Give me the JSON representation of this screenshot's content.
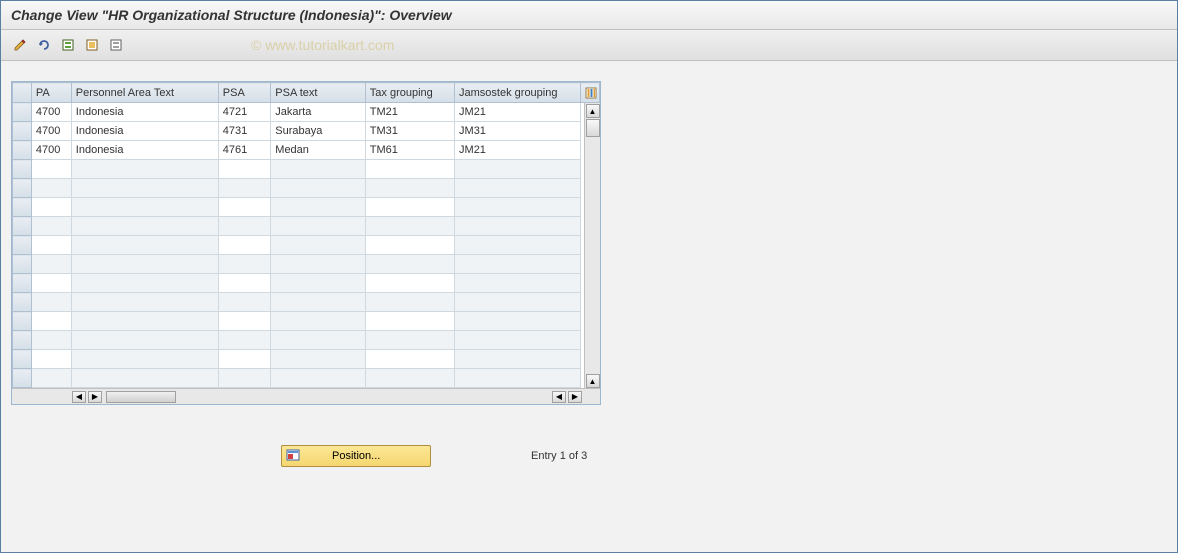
{
  "title": "Change View \"HR Organizational Structure (Indonesia)\": Overview",
  "watermark": "© www.tutorialkart.com",
  "toolbar": {
    "edit": "pencil-icon",
    "undo": "undo-icon",
    "select_all": "select-all-icon",
    "select_block": "select-block-icon",
    "deselect": "deselect-icon"
  },
  "table": {
    "columns": {
      "pa": "PA",
      "pat": "Personnel Area Text",
      "psa": "PSA",
      "psat": "PSA text",
      "tax": "Tax grouping",
      "jam": "Jamsostek grouping"
    },
    "rows": [
      {
        "pa": "4700",
        "pat": "Indonesia",
        "psa": "4721",
        "psat": "Jakarta",
        "tax": "TM21",
        "jam": "JM21"
      },
      {
        "pa": "4700",
        "pat": "Indonesia",
        "psa": "4731",
        "psat": "Surabaya",
        "tax": "TM31",
        "jam": "JM31"
      },
      {
        "pa": "4700",
        "pat": "Indonesia",
        "psa": "4761",
        "psat": "Medan",
        "tax": "TM61",
        "jam": "JM21"
      }
    ]
  },
  "footer": {
    "position_label": "Position...",
    "entry_text": "Entry 1 of 3"
  }
}
